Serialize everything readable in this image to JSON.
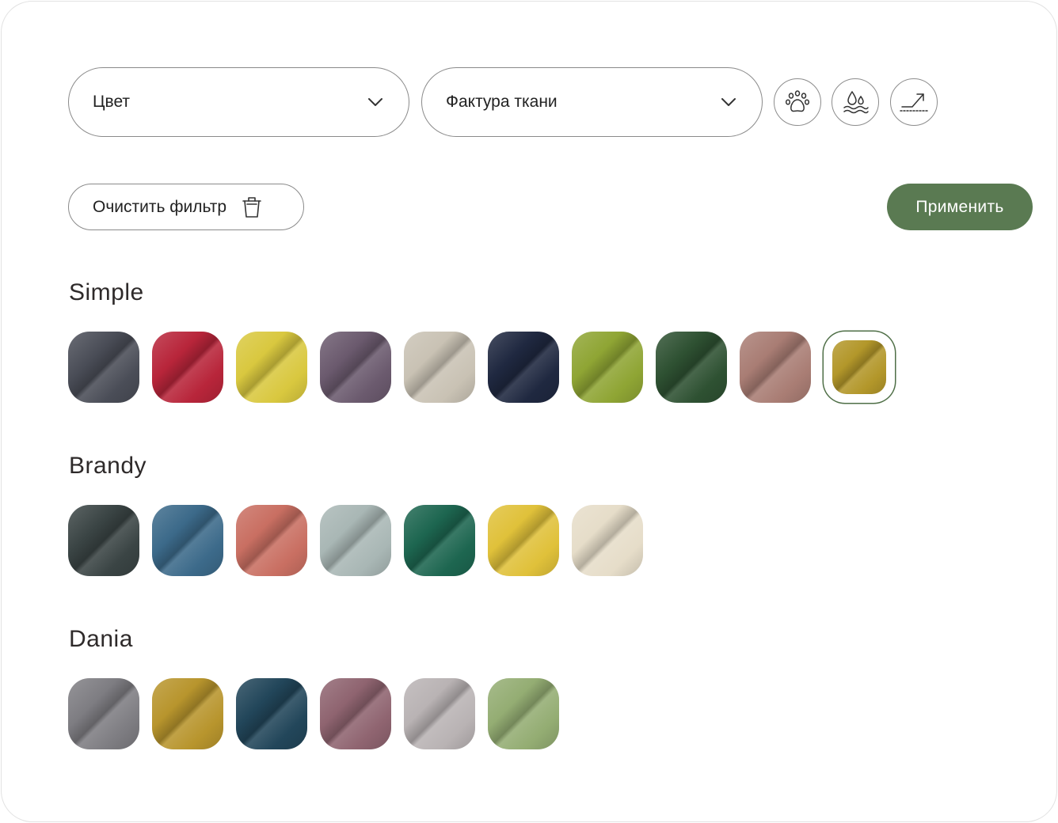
{
  "filters": {
    "color_select": {
      "label": "Цвет"
    },
    "texture_select": {
      "label": "Фактура ткани"
    },
    "features": [
      {
        "name": "pet-friendly-icon"
      },
      {
        "name": "water-repellent-icon"
      },
      {
        "name": "wear-resistant-icon"
      }
    ],
    "clear_label": "Очистить фильтр",
    "apply_label": "Применить",
    "accent_color": "#5a7a52"
  },
  "collections": [
    {
      "title": "Simple",
      "swatches": [
        "#4a4d57",
        "#b8253a",
        "#d9c83f",
        "#6b5a6e",
        "#c9c2b4",
        "#1f2840",
        "#8fa534",
        "#2e5132",
        "#a97d74",
        "#b3972a"
      ],
      "selected_index": 9
    },
    {
      "title": "Brandy",
      "swatches": [
        "#3a4444",
        "#3c6a8a",
        "#c96f62",
        "#a9b7b5",
        "#1d6650",
        "#e0c13a",
        "#e6ddc9"
      ]
    },
    {
      "title": "Dania",
      "swatches": [
        "#7e7d82",
        "#b8952d",
        "#22465a",
        "#8f6470",
        "#b9b3b4",
        "#94ad73"
      ]
    }
  ]
}
